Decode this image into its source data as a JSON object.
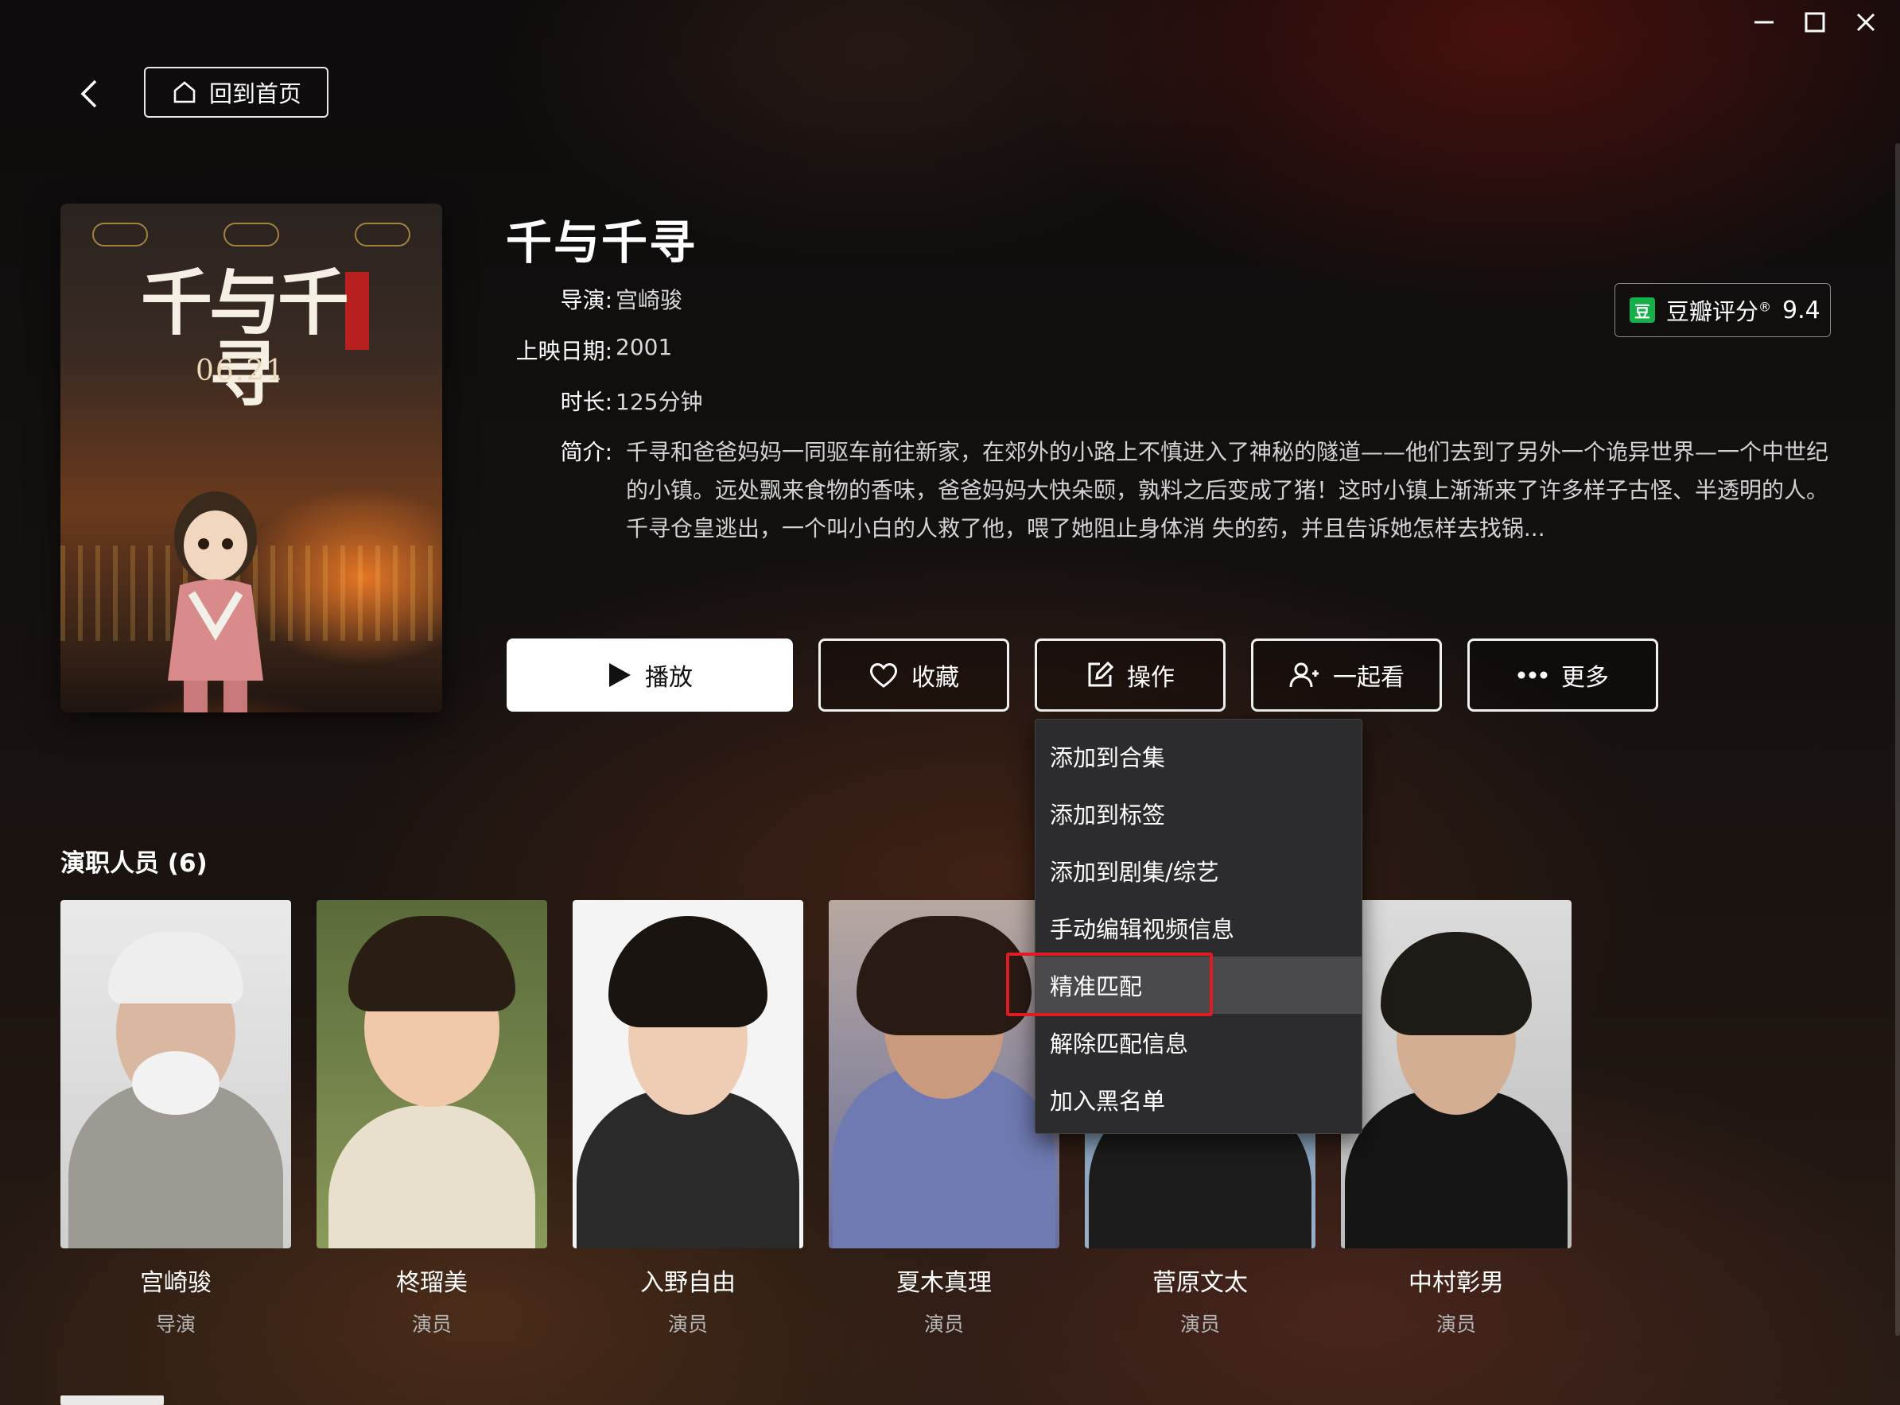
{
  "window": {
    "controls": [
      "minimize-icon",
      "maximize-icon",
      "close-icon"
    ]
  },
  "nav": {
    "home_label": "回到首页"
  },
  "movie": {
    "title": "千与千寻",
    "poster": {
      "title": "千与千寻",
      "date": "06.21"
    },
    "director_label": "导演:",
    "director": "宫崎骏",
    "release_label": "上映日期:",
    "release": "2001",
    "duration_label": "时长:",
    "duration": "125分钟",
    "synopsis_label": "简介:",
    "synopsis": "千寻和爸爸妈妈一同驱车前往新家，在郊外的小路上不慎进入了神秘的隧道——他们去到了另外一个诡异世界—一个中世纪的小镇。远处飘来食物的香味，爸爸妈妈大快朵颐，孰料之后变成了猪！这时小镇上渐渐来了许多样子古怪、半透明的人。千寻仓皇逃出，一个叫小白的人救了他，喂了她阻止身体消 失的药，并且告诉她怎样去找锅..."
  },
  "rating": {
    "icon_text": "豆",
    "label": "豆瓣评分",
    "mark": "®",
    "score": "9.4",
    "accent": "#16b04a"
  },
  "actions": {
    "play": "播放",
    "favorite": "收藏",
    "operate": "操作",
    "watch_together": "一起看",
    "more": "更多"
  },
  "menu": {
    "items": [
      "添加到合集",
      "添加到标签",
      "添加到剧集/综艺",
      "手动编辑视频信息",
      "精准匹配",
      "解除匹配信息",
      "加入黑名单"
    ],
    "active_index": 4,
    "highlight_color": "#e21b23"
  },
  "cast": {
    "heading": "演职人员 (6)",
    "members": [
      {
        "name": "宫崎骏",
        "role": "导演"
      },
      {
        "name": "柊瑠美",
        "role": "演员"
      },
      {
        "name": "入野自由",
        "role": "演员"
      },
      {
        "name": "夏木真理",
        "role": "演员"
      },
      {
        "name": "菅原文太",
        "role": "演员"
      },
      {
        "name": "中村彰男",
        "role": "演员"
      }
    ]
  }
}
